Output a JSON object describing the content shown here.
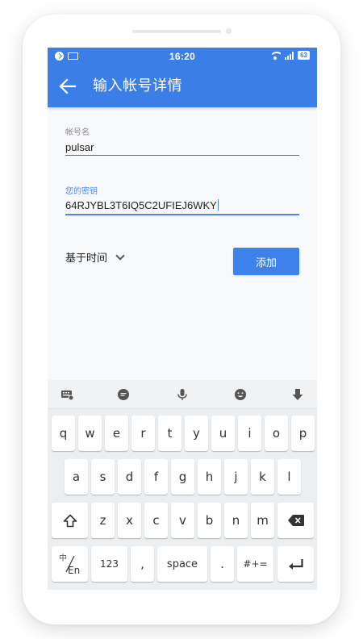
{
  "status_bar": {
    "time": "16:20",
    "battery": "63"
  },
  "app_bar": {
    "title": "输入帐号详情"
  },
  "form": {
    "account_label": "帐号名",
    "account_value": "pulsar",
    "key_label": "您的密钥",
    "key_value": "64RJYBL3T6IQ5C2UFIEJ6WKY",
    "type_select": "基于时间",
    "add_button": "添加"
  },
  "keyboard": {
    "row1": [
      "q",
      "w",
      "e",
      "r",
      "t",
      "y",
      "u",
      "i",
      "o",
      "p"
    ],
    "row2": [
      "a",
      "s",
      "d",
      "f",
      "g",
      "h",
      "j",
      "k",
      "l"
    ],
    "row3": [
      "z",
      "x",
      "c",
      "v",
      "b",
      "n",
      "m"
    ],
    "lang_top": "中",
    "lang_bottom": "En",
    "num_key": "123",
    "comma_key": ",",
    "space_key": "space",
    "period_key": ".",
    "symbols_key": "#+="
  },
  "colors": {
    "accent": "#3b7ee8",
    "field_active": "#4a87e8"
  }
}
